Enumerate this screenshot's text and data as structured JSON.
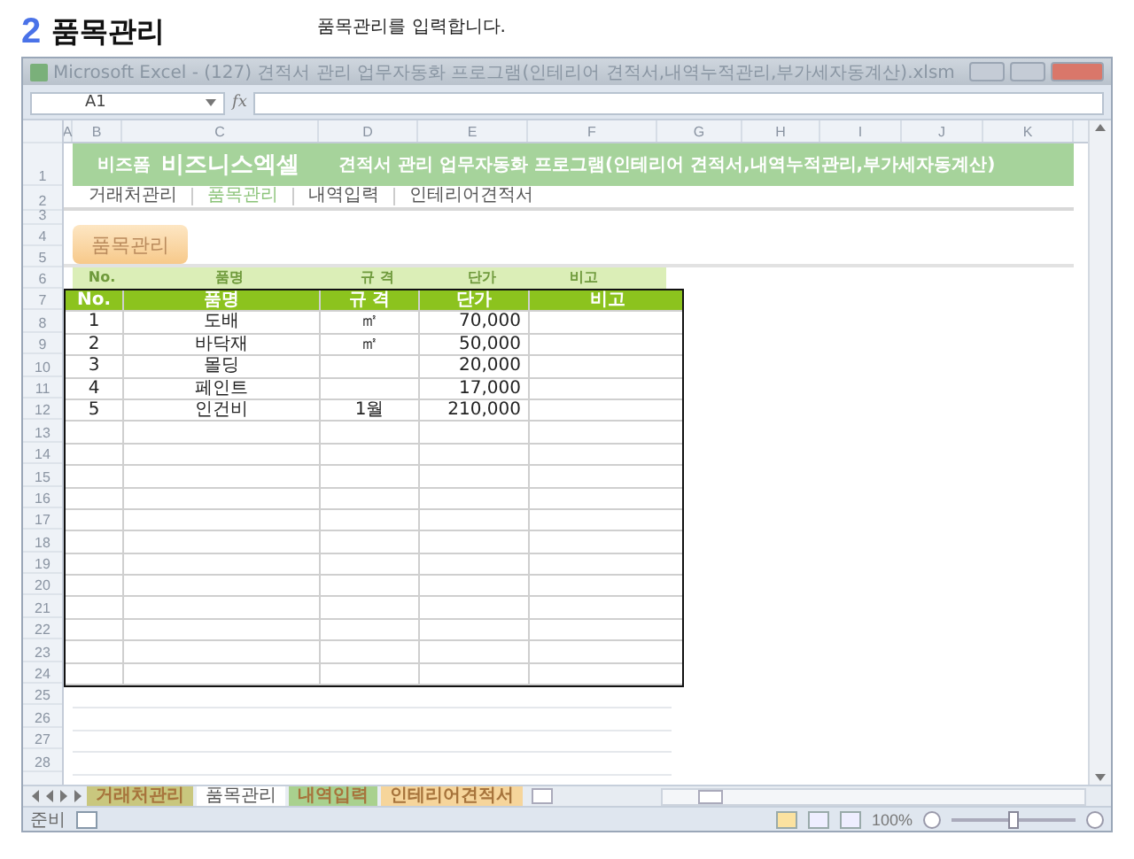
{
  "heading": {
    "number": "2",
    "title": "품목관리",
    "description": "품목관리를 입력합니다."
  },
  "window": {
    "title": "Microsoft Excel - (127) 견적서 관리 업무자동화 프로그램(인테리어 견적서,내역누적관리,부가세자동계산).xlsm"
  },
  "formula_bar": {
    "name_box": "A1",
    "fx": "fx"
  },
  "columns": [
    "A",
    "B",
    "C",
    "D",
    "E",
    "F",
    "G",
    "H",
    "I",
    "J",
    "K"
  ],
  "row_numbers": [
    "1",
    "2",
    "3",
    "4",
    "5",
    "6",
    "7",
    "8",
    "9",
    "10",
    "11",
    "12",
    "13",
    "14",
    "15",
    "16",
    "17",
    "18",
    "19",
    "20",
    "21",
    "22",
    "23",
    "24",
    "25",
    "26",
    "27",
    "28"
  ],
  "banner": {
    "brand_small": "비즈폼",
    "brand": "비즈니스엑셀",
    "title": "견적서 관리 업무자동화 프로그램(인테리어 견적서,내역누적관리,부가세자동계산)"
  },
  "nav": [
    {
      "label": "거래처관리",
      "selected": false
    },
    {
      "label": "품목관리",
      "selected": true
    },
    {
      "label": "내역입력",
      "selected": false
    },
    {
      "label": "인테리어견적서",
      "selected": false
    }
  ],
  "section_button": "품목관리",
  "shadow_header": [
    "No.",
    "품명",
    "규 격",
    "단가",
    "비고"
  ],
  "table": {
    "columns": [
      "No.",
      "품명",
      "규 격",
      "단가",
      "비고"
    ],
    "rows": [
      [
        "1",
        "도배",
        "㎡",
        "70,000",
        ""
      ],
      [
        "2",
        "바닥재",
        "㎡",
        "50,000",
        ""
      ],
      [
        "3",
        "몰딩",
        "",
        "20,000",
        ""
      ],
      [
        "4",
        "페인트",
        "",
        "17,000",
        ""
      ],
      [
        "5",
        "인건비",
        "1월",
        "210,000",
        ""
      ]
    ]
  },
  "sheet_tabs": [
    {
      "label": "거래처관리",
      "selected": false,
      "color": "#c9c77e"
    },
    {
      "label": "품목관리",
      "selected": true,
      "color": "#ffffff"
    },
    {
      "label": "내역입력",
      "selected": false,
      "color": "#a9d18e"
    },
    {
      "label": "인테리어견적서",
      "selected": false,
      "color": "#f6d59b"
    }
  ],
  "status_bar": {
    "text": "준비",
    "zoom": "100%",
    "zoom_slider": {
      "level": 0.5
    }
  }
}
